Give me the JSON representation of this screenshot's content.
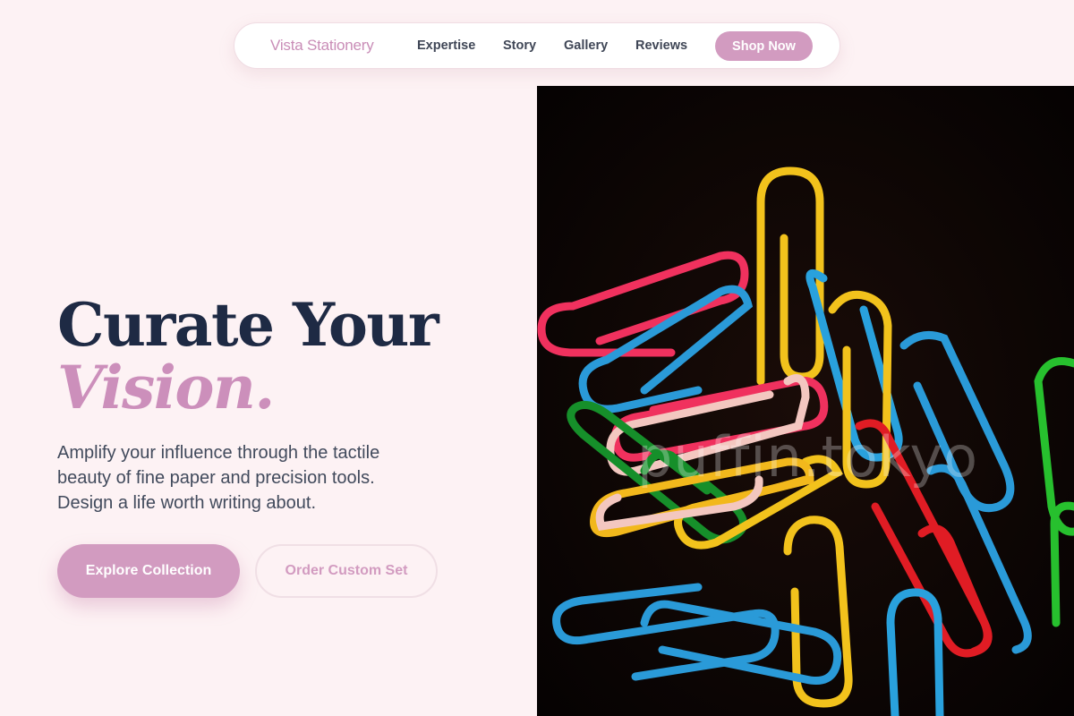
{
  "nav": {
    "brand": "Vista Stationery",
    "links": [
      "Expertise",
      "Story",
      "Gallery",
      "Reviews"
    ],
    "cta": "Shop Now"
  },
  "hero": {
    "headline": "Curate Your",
    "headline_accent": "Vision.",
    "subtext": "Amplify your influence through the tactile beauty of fine paper and precision tools. Design a life worth writing about.",
    "primary_button": "Explore Collection",
    "secondary_button": "Order Custom Set",
    "image_watermark": "puffin.tokyo"
  },
  "colors": {
    "accent": "#d29bc0",
    "heading": "#1e2a44",
    "background": "#fdf2f4"
  }
}
